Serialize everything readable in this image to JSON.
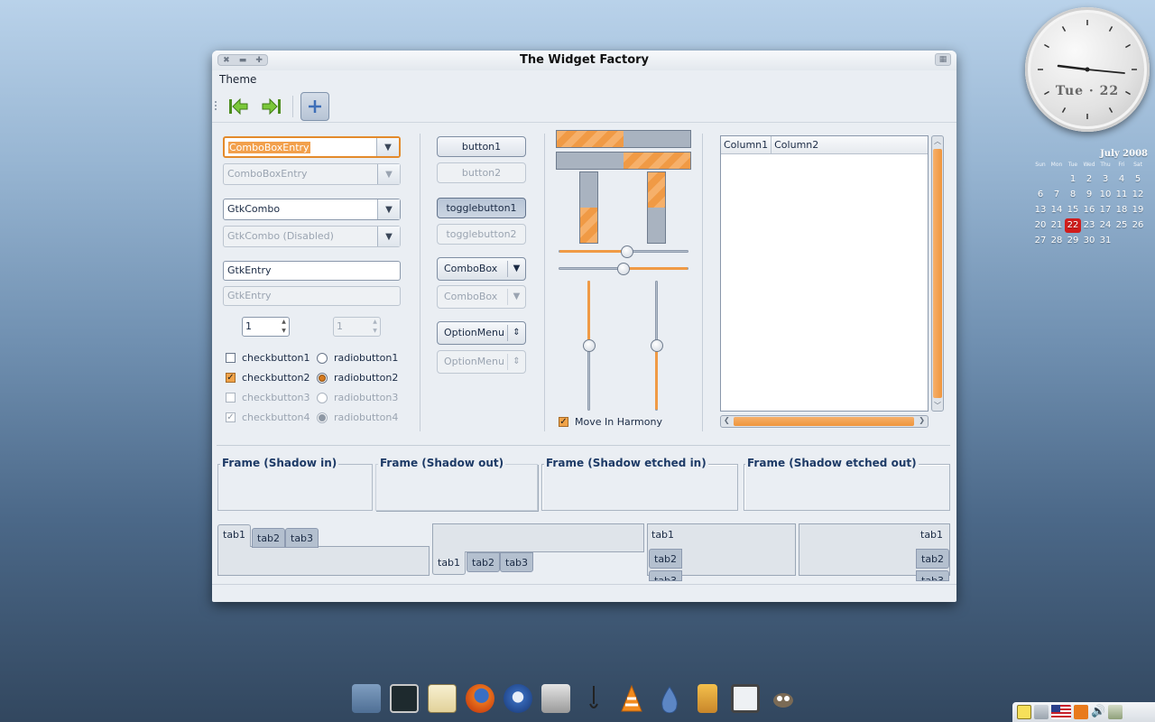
{
  "clock": {
    "date_label": "Tue · 22"
  },
  "calendar": {
    "title": "July 2008",
    "day_names": [
      "Sun",
      "Mon",
      "Tue",
      "Wed",
      "Thu",
      "Fri",
      "Sat"
    ],
    "weeks": [
      [
        "",
        "",
        "1",
        "2",
        "3",
        "4",
        "5"
      ],
      [
        "6",
        "7",
        "8",
        "9",
        "10",
        "11",
        "12"
      ],
      [
        "13",
        "14",
        "15",
        "16",
        "17",
        "18",
        "19"
      ],
      [
        "20",
        "21",
        "22",
        "23",
        "24",
        "25",
        "26"
      ],
      [
        "27",
        "28",
        "29",
        "30",
        "31",
        "",
        ""
      ]
    ],
    "today": "22"
  },
  "window": {
    "title": "The Widget Factory",
    "menu": [
      "Theme"
    ],
    "left": {
      "combo_entry": "ComboBoxEntry",
      "combo_entry_disabled": "ComboBoxEntry",
      "gtk_combo": "GtkCombo",
      "gtk_combo_disabled": "GtkCombo (Disabled)",
      "entry": "GtkEntry",
      "entry_disabled": "GtkEntry",
      "spin": "1",
      "spin_disabled": "1",
      "check1": "checkbutton1",
      "check2": "checkbutton2",
      "check3": "checkbutton3",
      "check4": "checkbutton4",
      "radio1": "radiobutton1",
      "radio2": "radiobutton2",
      "radio3": "radiobutton3",
      "radio4": "radiobutton4"
    },
    "buttons": {
      "button1": "button1",
      "button2": "button2",
      "toggle1": "togglebutton1",
      "toggle2": "togglebutton2",
      "combobox": "ComboBox",
      "combobox_disabled": "ComboBox",
      "optionmenu": "OptionMenu",
      "optionmenu_disabled": "OptionMenu"
    },
    "ranges": {
      "progress_h1": 0.5,
      "progress_h2": 0.5,
      "progress_v1": 0.5,
      "progress_v2": 0.5,
      "hscale1": 0.53,
      "hscale2": 0.5,
      "vscale1": 0.5,
      "vscale2": 0.5,
      "move_in_harmony": "Move In Harmony"
    },
    "tree": {
      "columns": [
        "Column1",
        "Column2"
      ]
    },
    "frames": [
      "Frame (Shadow in)",
      "Frame (Shadow out)",
      "Frame (Shadow etched in)",
      "Frame (Shadow etched out)"
    ],
    "tabs": [
      "tab1",
      "tab2",
      "tab3"
    ]
  },
  "dock": [
    "file-manager-icon",
    "terminal-icon",
    "text-editor-icon",
    "firefox-icon",
    "thunderbird-icon",
    "scripts-icon",
    "audio-icon",
    "vlc-icon",
    "water-icon",
    "archive-icon",
    "window-icon",
    "gimp-icon"
  ],
  "colors": {
    "accent": "#f09a45",
    "window_bg": "#eaeef3",
    "today": "#d01c1c"
  }
}
